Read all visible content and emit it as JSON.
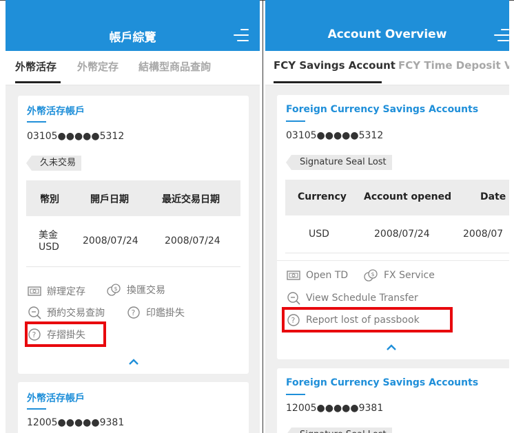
{
  "left": {
    "header": {
      "title": "帳戶綜覽"
    },
    "tabs": [
      {
        "label": "外幣活存"
      },
      {
        "label": "外幣定存"
      },
      {
        "label": "結構型商品查詢"
      }
    ],
    "card1": {
      "title": "外幣活存帳戶",
      "account": "03105●●●●●5312",
      "badge": "久未交易",
      "table": {
        "headers": [
          "幣別",
          "開戶日期",
          "最近交易日期"
        ],
        "row": {
          "currency_1": "美金",
          "currency_2": "USD",
          "opened": "2008/07/24",
          "last": "2008/07/24"
        }
      },
      "actions": [
        "辦理定存",
        "換匯交易",
        "預約交易查詢",
        "印鑑掛失",
        "存摺掛失"
      ]
    },
    "card2": {
      "title": "外幣活存帳戶",
      "account": "12005●●●●●9381"
    }
  },
  "right": {
    "header": {
      "title": "Account Overview"
    },
    "tabs": [
      {
        "label": "FCY Savings Account"
      },
      {
        "label": "FCY Time Deposit"
      },
      {
        "label": "Vi"
      }
    ],
    "card1": {
      "title": "Foreign Currency Savings Accounts",
      "account": "03105●●●●●5312",
      "badge": "Signature Seal Lost",
      "table": {
        "headers": [
          "Currency",
          "Account opened",
          "Date"
        ],
        "row": {
          "currency": "USD",
          "opened": "2008/07/24",
          "last": "2008/07"
        }
      },
      "actions": [
        "Open TD",
        "FX Service",
        "View Schedule Transfer",
        "Report lost of passbook"
      ]
    },
    "card2": {
      "title": "Foreign Currency Savings Accounts",
      "account": "12005●●●●●9381",
      "badge": "Signature Seal Lost"
    }
  },
  "colors": {
    "primary": "#1f8fd9",
    "highlight": "#e8070d",
    "background": "#efefef"
  }
}
